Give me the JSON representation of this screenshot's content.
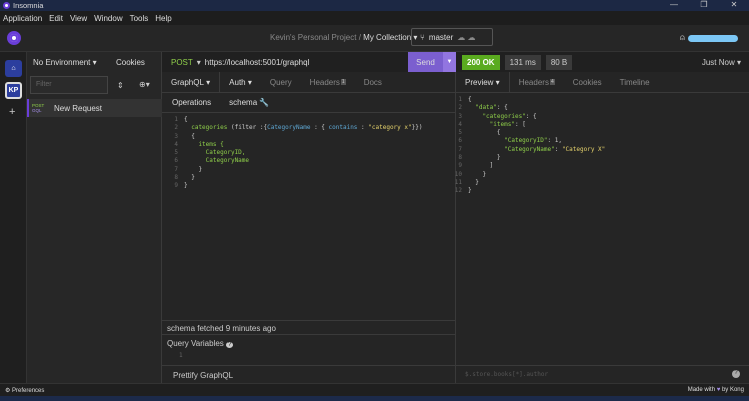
{
  "window": {
    "title": "Insomnia",
    "controls": [
      "—",
      "❐",
      "✕"
    ]
  },
  "menu": [
    "Application",
    "Edit",
    "View",
    "Window",
    "Tools",
    "Help"
  ],
  "header": {
    "project": "Kevin's Personal Project",
    "separator": "/",
    "collection": "My Collection",
    "branch": "master"
  },
  "rail": {
    "workspace_initials": "KP",
    "add": "+"
  },
  "sidebar": {
    "environment": "No Environment",
    "cookies": "Cookies",
    "filter_placeholder": "Filter",
    "request": {
      "method": "POST",
      "type": "GQL",
      "name": "New Request"
    }
  },
  "request": {
    "method": "POST",
    "url": "https://localhost:5001/graphql",
    "send": "Send",
    "tabs": [
      {
        "label": "GraphQL",
        "dropdown": true
      },
      {
        "label": "Auth",
        "dropdown": true
      },
      {
        "label": "Query"
      },
      {
        "label": "Headers",
        "badge": "1"
      },
      {
        "label": "Docs"
      }
    ],
    "subtabs": [
      "Operations",
      "schema"
    ],
    "code": [
      [
        {
          "t": "{",
          "c": "w"
        }
      ],
      [
        {
          "t": "  categories ",
          "c": "g"
        },
        {
          "t": "(filter :{",
          "c": "w"
        },
        {
          "t": "CategoryName",
          "c": "b"
        },
        {
          "t": " : { ",
          "c": "w"
        },
        {
          "t": "contains",
          "c": "b"
        },
        {
          "t": " : ",
          "c": "w"
        },
        {
          "t": "\"category x\"",
          "c": "y"
        },
        {
          "t": "}})",
          "c": "w"
        }
      ],
      [
        {
          "t": "  {",
          "c": "w"
        }
      ],
      [
        {
          "t": "    items {",
          "c": "g"
        }
      ],
      [
        {
          "t": "      CategoryID,",
          "c": "g"
        }
      ],
      [
        {
          "t": "      CategoryName",
          "c": "g"
        }
      ],
      [
        {
          "t": "    }",
          "c": "w"
        }
      ],
      [
        {
          "t": "  }",
          "c": "w"
        }
      ],
      [
        {
          "t": "}",
          "c": "w"
        }
      ]
    ],
    "schema_status": "schema fetched 9 minutes ago",
    "query_variables": "Query Variables",
    "variables_line": "1",
    "prettify": "Prettify GraphQL"
  },
  "response": {
    "status": "200 OK",
    "time": "131 ms",
    "size": "80 B",
    "history": "Just Now",
    "tabs": [
      {
        "label": "Preview",
        "dropdown": true
      },
      {
        "label": "Headers",
        "badge": "4"
      },
      {
        "label": "Cookies"
      },
      {
        "label": "Timeline"
      }
    ],
    "code": [
      [
        {
          "t": "{",
          "c": "w"
        }
      ],
      [
        {
          "t": "  \"data\"",
          "c": "g"
        },
        {
          "t": ": {",
          "c": "w"
        }
      ],
      [
        {
          "t": "    \"categories\"",
          "c": "g"
        },
        {
          "t": ": {",
          "c": "w"
        }
      ],
      [
        {
          "t": "      \"items\"",
          "c": "g"
        },
        {
          "t": ": [",
          "c": "w"
        }
      ],
      [
        {
          "t": "        {",
          "c": "w"
        }
      ],
      [
        {
          "t": "          \"CategoryID\"",
          "c": "g"
        },
        {
          "t": ": 1,",
          "c": "w"
        }
      ],
      [
        {
          "t": "          \"CategoryName\"",
          "c": "g"
        },
        {
          "t": ": ",
          "c": "w"
        },
        {
          "t": "\"Category X\"",
          "c": "y"
        }
      ],
      [
        {
          "t": "        }",
          "c": "w"
        }
      ],
      [
        {
          "t": "      ]",
          "c": "w"
        }
      ],
      [
        {
          "t": "    }",
          "c": "w"
        }
      ],
      [
        {
          "t": "  }",
          "c": "w"
        }
      ],
      [
        {
          "t": "}",
          "c": "w"
        }
      ]
    ],
    "filter_placeholder": "$.store.books[*].author"
  },
  "statusbar": {
    "preferences": "Preferences",
    "made_with": "Made with",
    "heart": "♥",
    "by": "by Kong"
  }
}
